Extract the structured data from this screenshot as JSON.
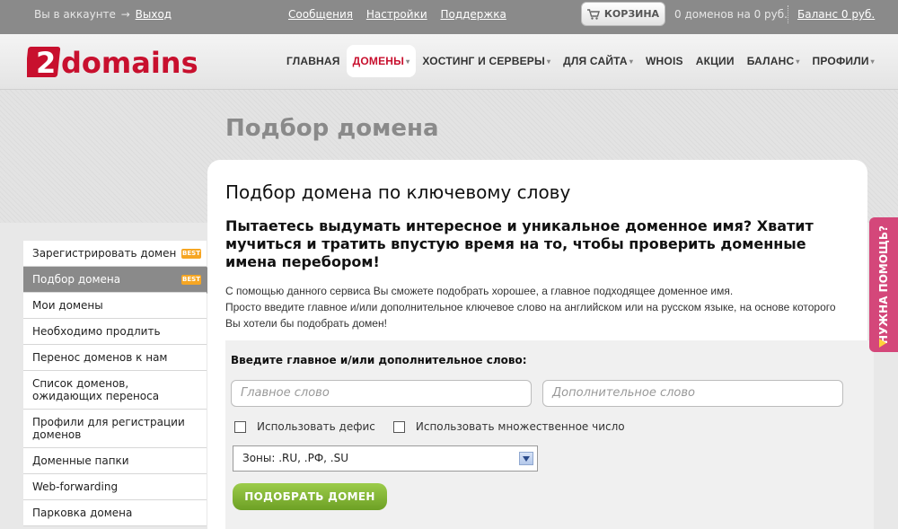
{
  "topbar": {
    "account_text": "Вы в аккаунте",
    "arrow": "→",
    "logout": "Выход",
    "links": [
      "Сообщения",
      "Настройки",
      "Поддержка"
    ],
    "cart_label": "КОРЗИНА",
    "cart_info": "0 доменов на 0 руб.",
    "balance": "Баланс 0 руб."
  },
  "logo": {
    "text": "2domains",
    "colors": {
      "brand": "#c8102e"
    }
  },
  "nav": {
    "items": [
      {
        "label": "ГЛАВНАЯ",
        "dropdown": false
      },
      {
        "label": "ДОМЕНЫ",
        "dropdown": true,
        "active": true
      },
      {
        "label": "ХОСТИНГ И СЕРВЕРЫ",
        "dropdown": true
      },
      {
        "label": "ДЛЯ САЙТА",
        "dropdown": true
      },
      {
        "label": "WHOIS",
        "dropdown": false
      },
      {
        "label": "АКЦИИ",
        "dropdown": false
      },
      {
        "label": "БАЛАНС",
        "dropdown": true
      },
      {
        "label": "ПРОФИЛИ",
        "dropdown": true
      }
    ],
    "dropdown_glyph": "▾"
  },
  "page_title": "Подбор домена",
  "sidebar": {
    "best_badge": "BEST",
    "items": [
      {
        "label": "Зарегистрировать домен",
        "best": true
      },
      {
        "label": "Подбор домена",
        "best": true,
        "active": true
      },
      {
        "label": "Мои домены"
      },
      {
        "label": "Необходимо продлить"
      },
      {
        "label": "Перенос доменов к нам"
      },
      {
        "label": "Список доменов, ожидающих переноса"
      },
      {
        "label": "Профили для регистрации доменов"
      },
      {
        "label": "Доменные папки"
      },
      {
        "label": "Web-forwarding"
      },
      {
        "label": "Парковка домена"
      }
    ]
  },
  "main": {
    "heading": "Подбор домена по ключевому слову",
    "subheading": "Пытаетесь выдумать интересное и уникальное доменное имя? Хватит мучиться и тратить впустую время на то, чтобы проверить доменные имена перебором!",
    "intro_line1": "С помощью данного сервиса Вы сможете подобрать хорошее, а главное подходящее доменное имя.",
    "intro_line2": "Просто введите главное и/или дополнительное ключевое слово на английском или на русском языке, на основе которого Вы хотели бы подобрать домен!"
  },
  "form": {
    "label": "Введите главное и/или дополнительное слово:",
    "main_placeholder": "Главное слово",
    "extra_placeholder": "Дополнительное слово",
    "checkbox_hyphen": "Использовать дефис",
    "checkbox_plural": "Использовать множественное число",
    "zones_select": "Зоны: .RU, .РФ, .SU",
    "submit": "ПОДОБРАТЬ ДОМЕН"
  },
  "help_tab": {
    "label": "НУЖНА ПОМОЩЬ?"
  }
}
